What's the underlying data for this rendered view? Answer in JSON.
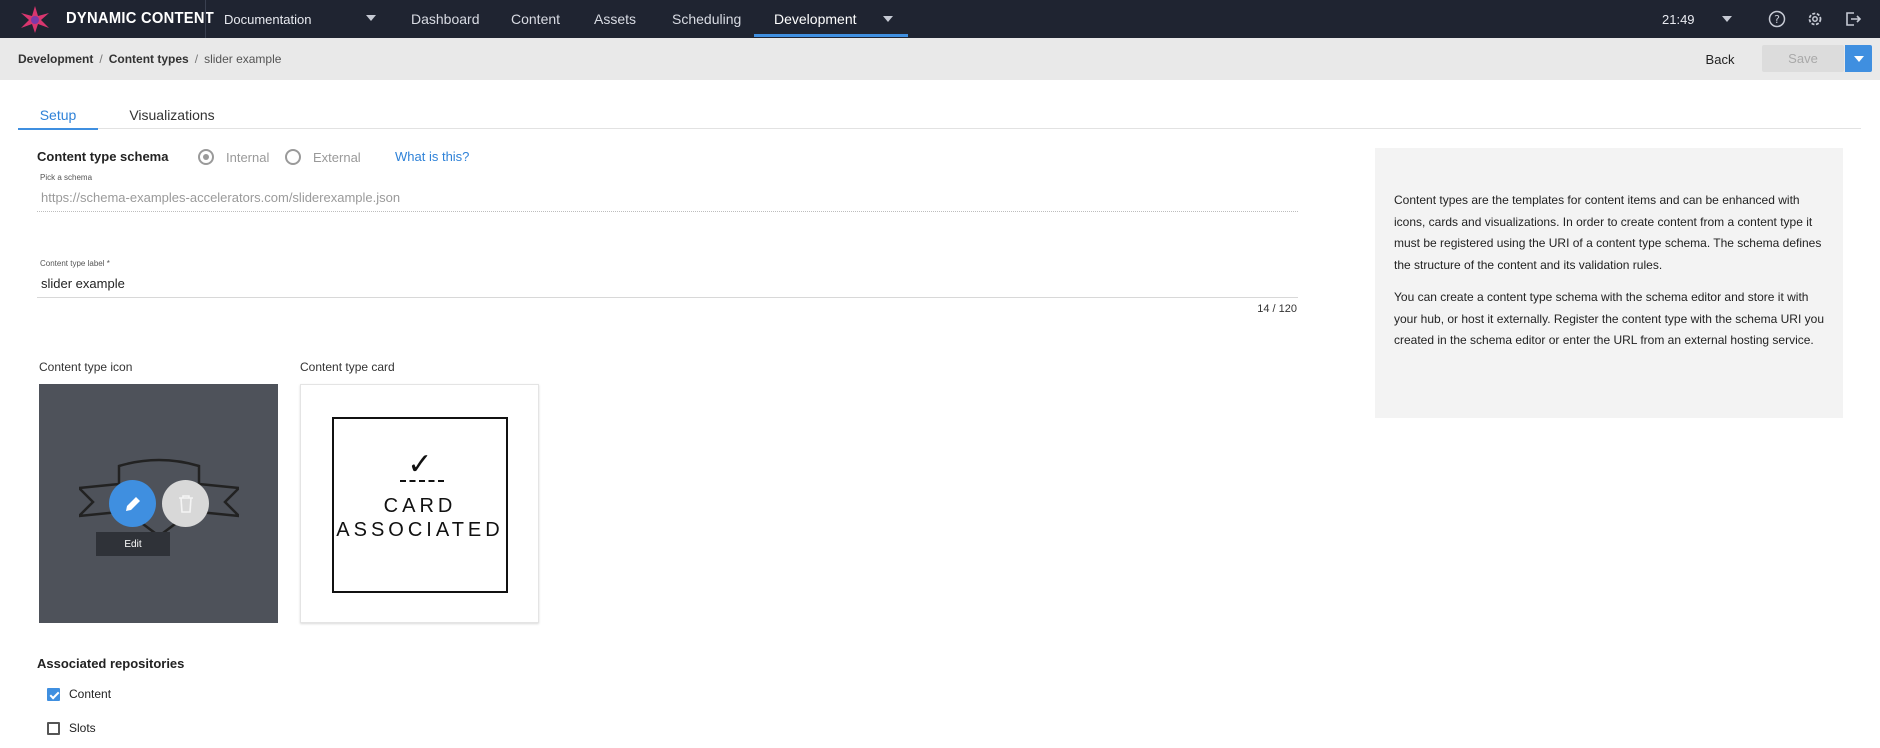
{
  "app": {
    "brand": "DYNAMIC CONTENT",
    "hub": "Documentation",
    "time": "21:49"
  },
  "nav": {
    "items": [
      {
        "label": "Dashboard"
      },
      {
        "label": "Content"
      },
      {
        "label": "Assets"
      },
      {
        "label": "Scheduling"
      },
      {
        "label": "Development",
        "active": true
      }
    ],
    "icons": [
      "help-icon",
      "gear-icon",
      "logout-icon"
    ]
  },
  "breadcrumb": {
    "level1": "Development",
    "level2": "Content types",
    "current": "slider example",
    "separator": "/"
  },
  "actions": {
    "back": "Back",
    "save": "Save"
  },
  "tabs": [
    {
      "label": "Setup",
      "active": true
    },
    {
      "label": "Visualizations"
    }
  ],
  "schema": {
    "label": "Content type schema",
    "options": [
      "Internal",
      "External"
    ],
    "selected": "Internal",
    "help_link": "What is this?",
    "pick_caption": "Pick a schema",
    "uri": "https://schema-examples-accelerators.com/sliderexample.json"
  },
  "content_label": {
    "caption": "Content type label *",
    "value": "slider example",
    "counter": "14 / 120"
  },
  "icon_section": {
    "label": "Content type icon",
    "tooltip": "Edit"
  },
  "card_section": {
    "label": "Content type card",
    "line1": "CARD",
    "line2": "ASSOCIATED"
  },
  "repositories": {
    "label": "Associated repositories",
    "items": [
      {
        "label": "Content",
        "checked": true
      },
      {
        "label": "Slots",
        "checked": false
      }
    ]
  },
  "info": {
    "paragraph1": "Content types are the templates for content items and can be enhanced with icons, cards and visualizations. In order to create content from a content type it must be registered using the URI of a content type schema. The schema defines the structure of the content and its validation rules.",
    "paragraph2": "You can create a content type schema with the schema editor and store it with your hub, or host it externally. Register the content type with the schema URI you created in the schema editor or enter the URL from an external hosting service."
  },
  "colors": {
    "topbar": "#1f2431",
    "accent": "#3f8fe0",
    "crumbbar": "#e9e9e9",
    "icon_tile": "#4e525a"
  }
}
